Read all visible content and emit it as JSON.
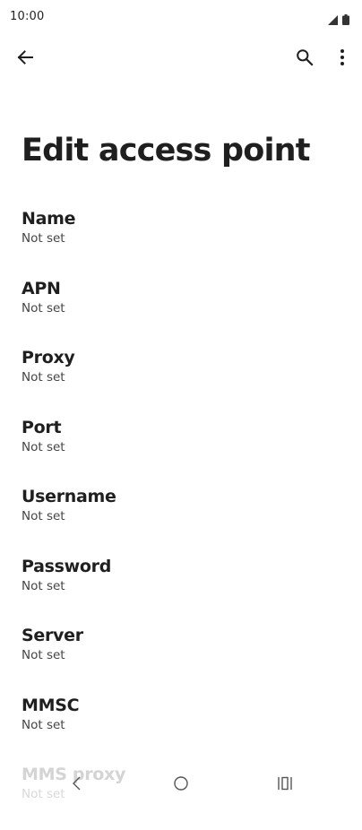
{
  "status_bar": {
    "time": "10:00",
    "icons": [
      "signal-icon",
      "battery-icon"
    ]
  },
  "app_bar": {
    "back_icon": "arrow-back-icon",
    "search_icon": "search-icon",
    "more_icon": "more-vert-icon"
  },
  "page": {
    "title": "Edit access point"
  },
  "fields": [
    {
      "label": "Name",
      "value": "Not set"
    },
    {
      "label": "APN",
      "value": "Not set"
    },
    {
      "label": "Proxy",
      "value": "Not set"
    },
    {
      "label": "Port",
      "value": "Not set"
    },
    {
      "label": "Username",
      "value": "Not set"
    },
    {
      "label": "Password",
      "value": "Not set"
    },
    {
      "label": "Server",
      "value": "Not set"
    },
    {
      "label": "MMSC",
      "value": "Not set"
    },
    {
      "label": "MMS proxy",
      "value": "Not set"
    }
  ],
  "nav_bar": {
    "icons": [
      "nav-back-icon",
      "nav-home-icon",
      "nav-recents-icon"
    ]
  }
}
